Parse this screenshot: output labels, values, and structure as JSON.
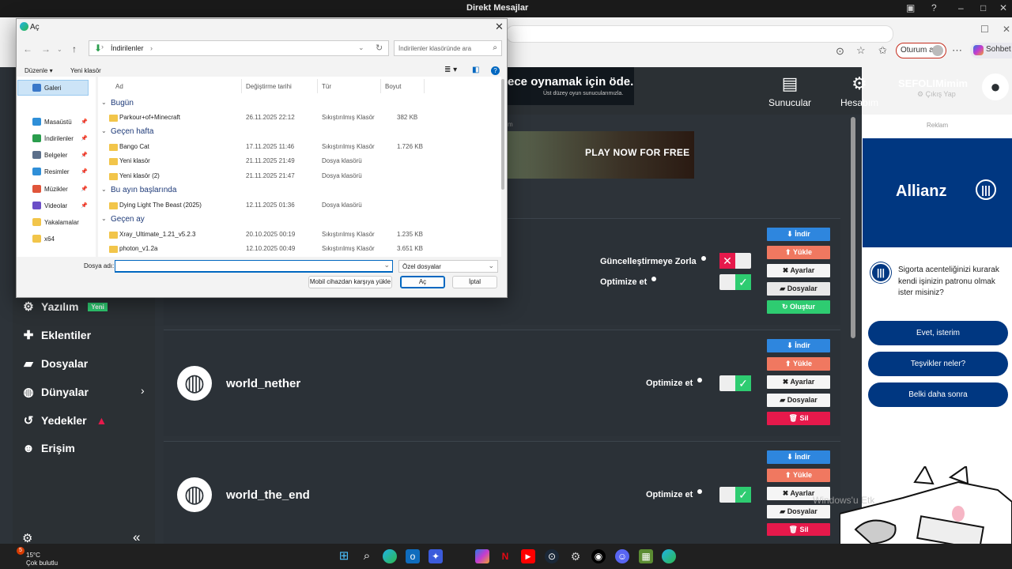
{
  "system": {
    "title": "Direkt Mesajlar"
  },
  "browser": {
    "signin_label": "Oturum aç",
    "copilot_label": "Sohbet e"
  },
  "page": {
    "nav": {
      "servers": "Sunucular",
      "account": "Hesabım",
      "username": "SEFOLIMimim",
      "logout": "Çıkış Yap"
    },
    "ads": {
      "banner1_title": "ece oynamak için öde.",
      "banner1_sub": "Üst düzey oyun sunucularımızla.",
      "ad_label": "m",
      "banner2_button": "PLAY NOW FOR FREE"
    },
    "sidebar": [
      {
        "label": "Yazılım",
        "badge": "Yeni",
        "icon": "gears-icon"
      },
      {
        "label": "Eklentiler",
        "icon": "puzzle-icon"
      },
      {
        "label": "Dosyalar",
        "icon": "folder-icon"
      },
      {
        "label": "Dünyalar",
        "icon": "globe-icon"
      },
      {
        "label": "Yedekler",
        "icon": "history-icon"
      },
      {
        "label": "Erişim",
        "icon": "user-gear-icon"
      }
    ],
    "world1": {
      "force_update": "Güncelleştirmeye Zorla",
      "optimize": "Optimize et",
      "buttons": {
        "download": "İndir",
        "upload": "Yükle",
        "settings": "Ayarlar",
        "files": "Dosyalar",
        "create": "Oluştur"
      }
    },
    "world2": {
      "name": "world_nether",
      "optimize": "Optimize et",
      "buttons": {
        "download": "İndir",
        "upload": "Yükle",
        "settings": "Ayarlar",
        "files": "Dosyalar",
        "delete": "Sil"
      }
    },
    "world3": {
      "name": "world_the_end",
      "optimize": "Optimize et",
      "buttons": {
        "download": "İndir",
        "upload": "Yükle",
        "settings": "Ayarlar",
        "files": "Dosyalar",
        "delete": "Sil"
      }
    }
  },
  "rightad": {
    "label": "Reklam",
    "brand": "Allianz",
    "question": "Sigorta acenteliğinizi kurarak kendi işinizin patronu olmak ister misiniz?",
    "options": [
      "Evet, isterim",
      "Teşvikler neler?",
      "Belki daha sonra"
    ]
  },
  "watermark": "Windows'u Etk",
  "dialog": {
    "title": "Aç",
    "path": "İndirilenler",
    "search_placeholder": "İndirilenler klasöründe ara",
    "organize": "Düzenle",
    "new_folder": "Yeni klasör",
    "nav": [
      {
        "label": "Galeri",
        "color": "#3a78c9"
      },
      {
        "label": "Masaüstü",
        "color": "#2f8fd8"
      },
      {
        "label": "İndirilenler",
        "color": "#2a9d4d"
      },
      {
        "label": "Belgeler",
        "color": "#5b6f8a"
      },
      {
        "label": "Resimler",
        "color": "#2f8fd8"
      },
      {
        "label": "Müzikler",
        "color": "#e0553a"
      },
      {
        "label": "Videolar",
        "color": "#6b4fc7"
      },
      {
        "label": "Yakalamalar",
        "color": "#f2c54a"
      },
      {
        "label": "x64",
        "color": "#f2c54a"
      }
    ],
    "columns": [
      "Ad",
      "Değiştirme tarihi",
      "Tür",
      "Boyut"
    ],
    "groups": [
      {
        "name": "Bugün",
        "files": [
          {
            "name": "Parkour+of+Minecraft",
            "date": "26.11.2025 22:12",
            "type": "Sıkıştırılmış Klasör",
            "size": "382 KB"
          }
        ]
      },
      {
        "name": "Geçen hafta",
        "files": [
          {
            "name": "Bango Cat",
            "date": "17.11.2025 11:46",
            "type": "Sıkıştırılmış Klasör",
            "size": "1.726 KB"
          },
          {
            "name": "Yeni klasör",
            "date": "21.11.2025 21:49",
            "type": "Dosya klasörü",
            "size": ""
          },
          {
            "name": "Yeni klasör (2)",
            "date": "21.11.2025 21:47",
            "type": "Dosya klasörü",
            "size": ""
          }
        ]
      },
      {
        "name": "Bu ayın başlarında",
        "files": [
          {
            "name": "Dying Light The Beast (2025)",
            "date": "12.11.2025 01:36",
            "type": "Dosya klasörü",
            "size": ""
          }
        ]
      },
      {
        "name": "Geçen ay",
        "files": [
          {
            "name": "Xray_Ultimate_1.21_v5.2.3",
            "date": "20.10.2025 00:19",
            "type": "Sıkıştırılmış Klasör",
            "size": "1.235 KB"
          },
          {
            "name": "photon_v1.2a",
            "date": "12.10.2025 00:49",
            "type": "Sıkıştırılmış Klasör",
            "size": "3.651 KB"
          }
        ]
      }
    ],
    "filename_label": "Dosya adı:",
    "filename_value": "",
    "filter": "Özel dosyalar",
    "mobile_upload": "Mobil cihazdan karşıya yükle",
    "open": "Aç",
    "cancel": "İptal"
  },
  "taskbar": {
    "temperature": "15°C",
    "weather": "Çok bulutlu",
    "notification_count": "5"
  }
}
